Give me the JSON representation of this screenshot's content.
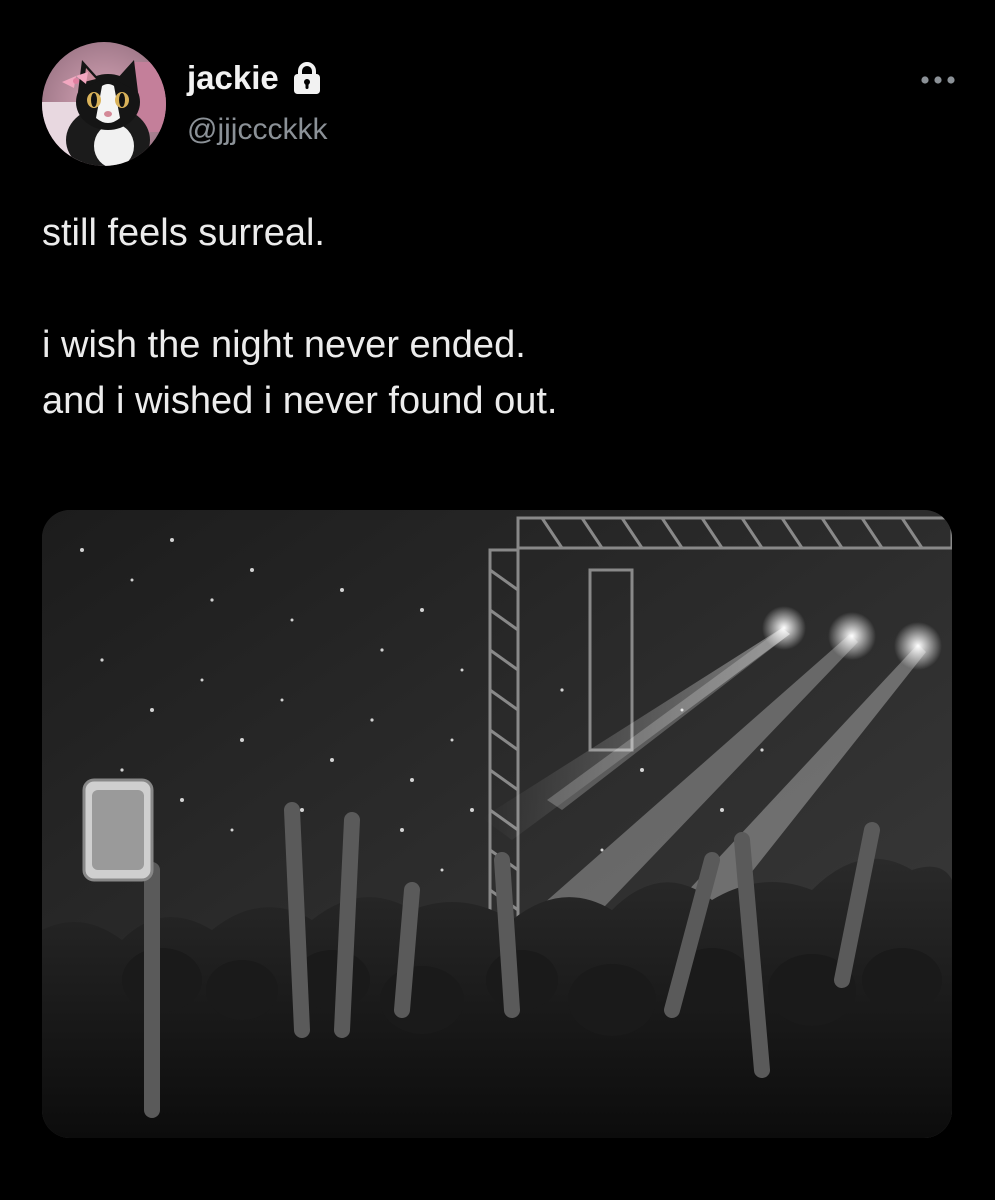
{
  "user": {
    "display_name": "jackie",
    "handle": "@jjjccckkk",
    "verified_icon": "lock-icon",
    "avatar_icon": "cat-avatar"
  },
  "header": {
    "more_icon": "more-horizontal-icon"
  },
  "tweet": {
    "lines": [
      "still feels surreal.",
      "i wish the night never ended.",
      "and i wished i never found out."
    ]
  },
  "media": {
    "type": "photo",
    "subject": "black-and-white concert crowd photo",
    "icon": "concert-photo"
  },
  "colors": {
    "background": "#000000",
    "text": "#e7e9ea",
    "secondary_text": "#8b9197"
  }
}
